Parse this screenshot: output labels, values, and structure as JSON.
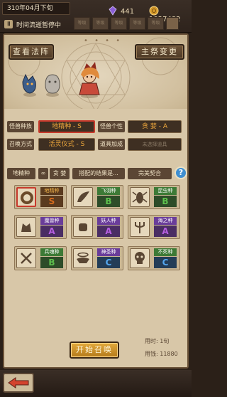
{
  "topbar": {
    "date": "310年04月下旬",
    "crystal_count": "441",
    "coin_count": "1027482",
    "pause_icon": "pause-icon",
    "pause_text": "时间流逝暂停中",
    "slots": [
      "等级",
      "等级",
      "等级",
      "等级",
      "等级"
    ]
  },
  "scene": {
    "btn_formation": "查看法阵",
    "btn_change": "主祭变更",
    "dots": "• • • •"
  },
  "config": {
    "race_label": "怪兽种族",
    "race_value": "地精种 - S",
    "trait_label": "怪兽个性",
    "trait_value": "贪 婪 - A",
    "method_label": "召唤方式",
    "method_value": "活灵仪式 - S",
    "bonus_label": "道具加成",
    "bonus_value": "未选择道具"
  },
  "tabs": {
    "race": "地精种",
    "link": "∞",
    "trait": "贪 婪",
    "result": "搭配的结果是...",
    "perfect": "完美契合",
    "help": "?"
  },
  "grid": [
    {
      "name": "地精种",
      "rank": "S",
      "name_style": "earth",
      "icon": "goblin-icon",
      "selected": true
    },
    {
      "name": "飞羽种",
      "rank": "B",
      "name_style": "green",
      "icon": "feather-wing-icon",
      "selected": false
    },
    {
      "name": "昆虫种",
      "rank": "B",
      "name_style": "green",
      "icon": "insect-icon",
      "selected": false
    },
    {
      "name": "魔兽种",
      "rank": "A",
      "name_style": "purple",
      "icon": "beast-icon",
      "selected": false
    },
    {
      "name": "妖人种",
      "rank": "A",
      "name_style": "purple",
      "icon": "fist-icon",
      "selected": false
    },
    {
      "name": "海之种",
      "rank": "A",
      "name_style": "purple",
      "icon": "trident-icon",
      "selected": false
    },
    {
      "name": "兵魂种",
      "rank": "B",
      "name_style": "green",
      "icon": "soldier-icon",
      "selected": false
    },
    {
      "name": "神圣种",
      "rank": "C",
      "name_style": "purple",
      "icon": "halo-icon",
      "selected": false
    },
    {
      "name": "不死种",
      "rank": "C",
      "name_style": "green",
      "icon": "skull-icon",
      "selected": false
    }
  ],
  "footer": {
    "start": "开始召唤",
    "time": "用时: 1旬",
    "cost": "用钱: 11880",
    "back_icon": "back-arrow-icon"
  }
}
